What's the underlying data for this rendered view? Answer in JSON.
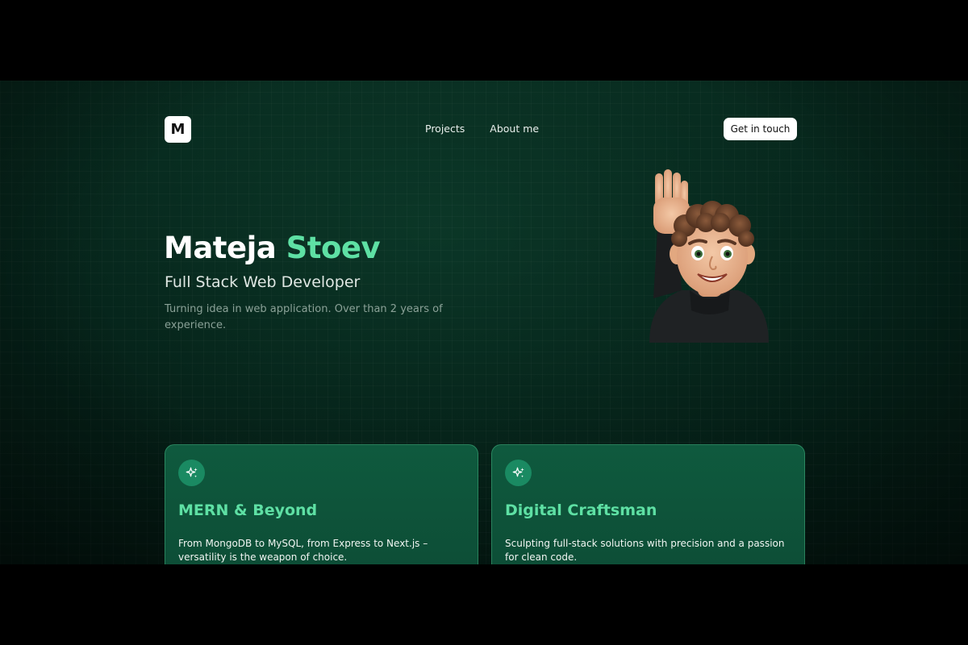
{
  "nav": {
    "logo_letter": "M",
    "links": [
      {
        "label": "Projects"
      },
      {
        "label": "About me"
      }
    ],
    "cta_label": "Get in touch"
  },
  "hero": {
    "first_name": "Mateja",
    "last_name": "Stoev",
    "role": "Full Stack Web Developer",
    "description": "Turning idea in web application. Over than 2 years of experience."
  },
  "cards": [
    {
      "icon": "sparkles-icon",
      "title": "MERN & Beyond",
      "text": "From MongoDB to MySQL, from Express to Next.js – versatility is the weapon of choice."
    },
    {
      "icon": "sparkles-icon",
      "title": "Digital Craftsman",
      "text": "Sculpting full-stack solutions with precision and a passion for clean code."
    }
  ],
  "colors": {
    "accent": "#5ee0a4",
    "background": "#052219",
    "card_background": "#0f5a3e",
    "icon_circle": "#1a8a62"
  }
}
